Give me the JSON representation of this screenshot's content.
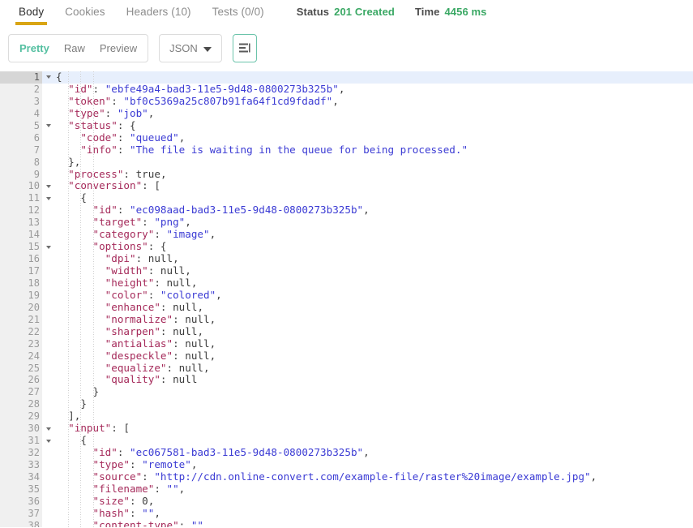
{
  "topbar": {
    "tabs": [
      {
        "label": "Body",
        "active": true
      },
      {
        "label": "Cookies",
        "active": false
      },
      {
        "label": "Headers (10)",
        "active": false
      },
      {
        "label": "Tests (0/0)",
        "active": false
      }
    ],
    "status_label": "Status",
    "status_value": "201 Created",
    "time_label": "Time",
    "time_value": "4456 ms",
    "accent_underline": "#d9a514",
    "status_color": "#3aa864"
  },
  "toolbar": {
    "view_modes": [
      {
        "label": "Pretty",
        "active": true
      },
      {
        "label": "Raw",
        "active": false
      },
      {
        "label": "Preview",
        "active": false
      }
    ],
    "language": "JSON",
    "format_icon": "word-wrap-icon",
    "chevron_icon": "chevron-down-icon",
    "active_color": "#53bfa0"
  },
  "editor": {
    "active_line": 1,
    "lines": [
      {
        "n": 1,
        "fold": true,
        "indent": 0,
        "tokens": [
          {
            "t": "p",
            "v": "{"
          }
        ]
      },
      {
        "n": 2,
        "fold": false,
        "indent": 1,
        "tokens": [
          {
            "t": "k",
            "v": "\"id\""
          },
          {
            "t": "p",
            "v": ": "
          },
          {
            "t": "s",
            "v": "\"ebfe49a4-bad3-11e5-9d48-0800273b325b\""
          },
          {
            "t": "p",
            "v": ","
          }
        ]
      },
      {
        "n": 3,
        "fold": false,
        "indent": 1,
        "tokens": [
          {
            "t": "k",
            "v": "\"token\""
          },
          {
            "t": "p",
            "v": ": "
          },
          {
            "t": "s",
            "v": "\"bf0c5369a25c807b91fa64f1cd9fdadf\""
          },
          {
            "t": "p",
            "v": ","
          }
        ]
      },
      {
        "n": 4,
        "fold": false,
        "indent": 1,
        "tokens": [
          {
            "t": "k",
            "v": "\"type\""
          },
          {
            "t": "p",
            "v": ": "
          },
          {
            "t": "s",
            "v": "\"job\""
          },
          {
            "t": "p",
            "v": ","
          }
        ]
      },
      {
        "n": 5,
        "fold": true,
        "indent": 1,
        "tokens": [
          {
            "t": "k",
            "v": "\"status\""
          },
          {
            "t": "p",
            "v": ": {"
          }
        ]
      },
      {
        "n": 6,
        "fold": false,
        "indent": 2,
        "tokens": [
          {
            "t": "k",
            "v": "\"code\""
          },
          {
            "t": "p",
            "v": ": "
          },
          {
            "t": "s",
            "v": "\"queued\""
          },
          {
            "t": "p",
            "v": ","
          }
        ]
      },
      {
        "n": 7,
        "fold": false,
        "indent": 2,
        "tokens": [
          {
            "t": "k",
            "v": "\"info\""
          },
          {
            "t": "p",
            "v": ": "
          },
          {
            "t": "s",
            "v": "\"The file is waiting in the queue for being processed.\""
          }
        ]
      },
      {
        "n": 8,
        "fold": false,
        "indent": 1,
        "tokens": [
          {
            "t": "p",
            "v": "},"
          }
        ]
      },
      {
        "n": 9,
        "fold": false,
        "indent": 1,
        "tokens": [
          {
            "t": "k",
            "v": "\"process\""
          },
          {
            "t": "p",
            "v": ": "
          },
          {
            "t": "b",
            "v": "true"
          },
          {
            "t": "p",
            "v": ","
          }
        ]
      },
      {
        "n": 10,
        "fold": true,
        "indent": 1,
        "tokens": [
          {
            "t": "k",
            "v": "\"conversion\""
          },
          {
            "t": "p",
            "v": ": ["
          }
        ]
      },
      {
        "n": 11,
        "fold": true,
        "indent": 2,
        "tokens": [
          {
            "t": "p",
            "v": "{"
          }
        ]
      },
      {
        "n": 12,
        "fold": false,
        "indent": 3,
        "tokens": [
          {
            "t": "k",
            "v": "\"id\""
          },
          {
            "t": "p",
            "v": ": "
          },
          {
            "t": "s",
            "v": "\"ec098aad-bad3-11e5-9d48-0800273b325b\""
          },
          {
            "t": "p",
            "v": ","
          }
        ]
      },
      {
        "n": 13,
        "fold": false,
        "indent": 3,
        "tokens": [
          {
            "t": "k",
            "v": "\"target\""
          },
          {
            "t": "p",
            "v": ": "
          },
          {
            "t": "s",
            "v": "\"png\""
          },
          {
            "t": "p",
            "v": ","
          }
        ]
      },
      {
        "n": 14,
        "fold": false,
        "indent": 3,
        "tokens": [
          {
            "t": "k",
            "v": "\"category\""
          },
          {
            "t": "p",
            "v": ": "
          },
          {
            "t": "s",
            "v": "\"image\""
          },
          {
            "t": "p",
            "v": ","
          }
        ]
      },
      {
        "n": 15,
        "fold": true,
        "indent": 3,
        "tokens": [
          {
            "t": "k",
            "v": "\"options\""
          },
          {
            "t": "p",
            "v": ": {"
          }
        ]
      },
      {
        "n": 16,
        "fold": false,
        "indent": 4,
        "tokens": [
          {
            "t": "k",
            "v": "\"dpi\""
          },
          {
            "t": "p",
            "v": ": "
          },
          {
            "t": "n",
            "v": "null"
          },
          {
            "t": "p",
            "v": ","
          }
        ]
      },
      {
        "n": 17,
        "fold": false,
        "indent": 4,
        "tokens": [
          {
            "t": "k",
            "v": "\"width\""
          },
          {
            "t": "p",
            "v": ": "
          },
          {
            "t": "n",
            "v": "null"
          },
          {
            "t": "p",
            "v": ","
          }
        ]
      },
      {
        "n": 18,
        "fold": false,
        "indent": 4,
        "tokens": [
          {
            "t": "k",
            "v": "\"height\""
          },
          {
            "t": "p",
            "v": ": "
          },
          {
            "t": "n",
            "v": "null"
          },
          {
            "t": "p",
            "v": ","
          }
        ]
      },
      {
        "n": 19,
        "fold": false,
        "indent": 4,
        "tokens": [
          {
            "t": "k",
            "v": "\"color\""
          },
          {
            "t": "p",
            "v": ": "
          },
          {
            "t": "s",
            "v": "\"colored\""
          },
          {
            "t": "p",
            "v": ","
          }
        ]
      },
      {
        "n": 20,
        "fold": false,
        "indent": 4,
        "tokens": [
          {
            "t": "k",
            "v": "\"enhance\""
          },
          {
            "t": "p",
            "v": ": "
          },
          {
            "t": "n",
            "v": "null"
          },
          {
            "t": "p",
            "v": ","
          }
        ]
      },
      {
        "n": 21,
        "fold": false,
        "indent": 4,
        "tokens": [
          {
            "t": "k",
            "v": "\"normalize\""
          },
          {
            "t": "p",
            "v": ": "
          },
          {
            "t": "n",
            "v": "null"
          },
          {
            "t": "p",
            "v": ","
          }
        ]
      },
      {
        "n": 22,
        "fold": false,
        "indent": 4,
        "tokens": [
          {
            "t": "k",
            "v": "\"sharpen\""
          },
          {
            "t": "p",
            "v": ": "
          },
          {
            "t": "n",
            "v": "null"
          },
          {
            "t": "p",
            "v": ","
          }
        ]
      },
      {
        "n": 23,
        "fold": false,
        "indent": 4,
        "tokens": [
          {
            "t": "k",
            "v": "\"antialias\""
          },
          {
            "t": "p",
            "v": ": "
          },
          {
            "t": "n",
            "v": "null"
          },
          {
            "t": "p",
            "v": ","
          }
        ]
      },
      {
        "n": 24,
        "fold": false,
        "indent": 4,
        "tokens": [
          {
            "t": "k",
            "v": "\"despeckle\""
          },
          {
            "t": "p",
            "v": ": "
          },
          {
            "t": "n",
            "v": "null"
          },
          {
            "t": "p",
            "v": ","
          }
        ]
      },
      {
        "n": 25,
        "fold": false,
        "indent": 4,
        "tokens": [
          {
            "t": "k",
            "v": "\"equalize\""
          },
          {
            "t": "p",
            "v": ": "
          },
          {
            "t": "n",
            "v": "null"
          },
          {
            "t": "p",
            "v": ","
          }
        ]
      },
      {
        "n": 26,
        "fold": false,
        "indent": 4,
        "tokens": [
          {
            "t": "k",
            "v": "\"quality\""
          },
          {
            "t": "p",
            "v": ": "
          },
          {
            "t": "n",
            "v": "null"
          }
        ]
      },
      {
        "n": 27,
        "fold": false,
        "indent": 3,
        "tokens": [
          {
            "t": "p",
            "v": "}"
          }
        ]
      },
      {
        "n": 28,
        "fold": false,
        "indent": 2,
        "tokens": [
          {
            "t": "p",
            "v": "}"
          }
        ]
      },
      {
        "n": 29,
        "fold": false,
        "indent": 1,
        "tokens": [
          {
            "t": "p",
            "v": "],"
          }
        ]
      },
      {
        "n": 30,
        "fold": true,
        "indent": 1,
        "tokens": [
          {
            "t": "k",
            "v": "\"input\""
          },
          {
            "t": "p",
            "v": ": ["
          }
        ]
      },
      {
        "n": 31,
        "fold": true,
        "indent": 2,
        "tokens": [
          {
            "t": "p",
            "v": "{"
          }
        ]
      },
      {
        "n": 32,
        "fold": false,
        "indent": 3,
        "tokens": [
          {
            "t": "k",
            "v": "\"id\""
          },
          {
            "t": "p",
            "v": ": "
          },
          {
            "t": "s",
            "v": "\"ec067581-bad3-11e5-9d48-0800273b325b\""
          },
          {
            "t": "p",
            "v": ","
          }
        ]
      },
      {
        "n": 33,
        "fold": false,
        "indent": 3,
        "tokens": [
          {
            "t": "k",
            "v": "\"type\""
          },
          {
            "t": "p",
            "v": ": "
          },
          {
            "t": "s",
            "v": "\"remote\""
          },
          {
            "t": "p",
            "v": ","
          }
        ]
      },
      {
        "n": 34,
        "fold": false,
        "indent": 3,
        "tokens": [
          {
            "t": "k",
            "v": "\"source\""
          },
          {
            "t": "p",
            "v": ": "
          },
          {
            "t": "s",
            "v": "\"http://cdn.online-convert.com/example-file/raster%20image/example.jpg\""
          },
          {
            "t": "p",
            "v": ","
          }
        ]
      },
      {
        "n": 35,
        "fold": false,
        "indent": 3,
        "tokens": [
          {
            "t": "k",
            "v": "\"filename\""
          },
          {
            "t": "p",
            "v": ": "
          },
          {
            "t": "s",
            "v": "\"\""
          },
          {
            "t": "p",
            "v": ","
          }
        ]
      },
      {
        "n": 36,
        "fold": false,
        "indent": 3,
        "tokens": [
          {
            "t": "k",
            "v": "\"size\""
          },
          {
            "t": "p",
            "v": ": "
          },
          {
            "t": "n",
            "v": "0"
          },
          {
            "t": "p",
            "v": ","
          }
        ]
      },
      {
        "n": 37,
        "fold": false,
        "indent": 3,
        "tokens": [
          {
            "t": "k",
            "v": "\"hash\""
          },
          {
            "t": "p",
            "v": ": "
          },
          {
            "t": "s",
            "v": "\"\""
          },
          {
            "t": "p",
            "v": ","
          }
        ]
      },
      {
        "n": 38,
        "fold": false,
        "indent": 3,
        "tokens": [
          {
            "t": "k",
            "v": "\"content-type\""
          },
          {
            "t": "p",
            "v": ": "
          },
          {
            "t": "s",
            "v": "\"\""
          }
        ]
      }
    ]
  }
}
